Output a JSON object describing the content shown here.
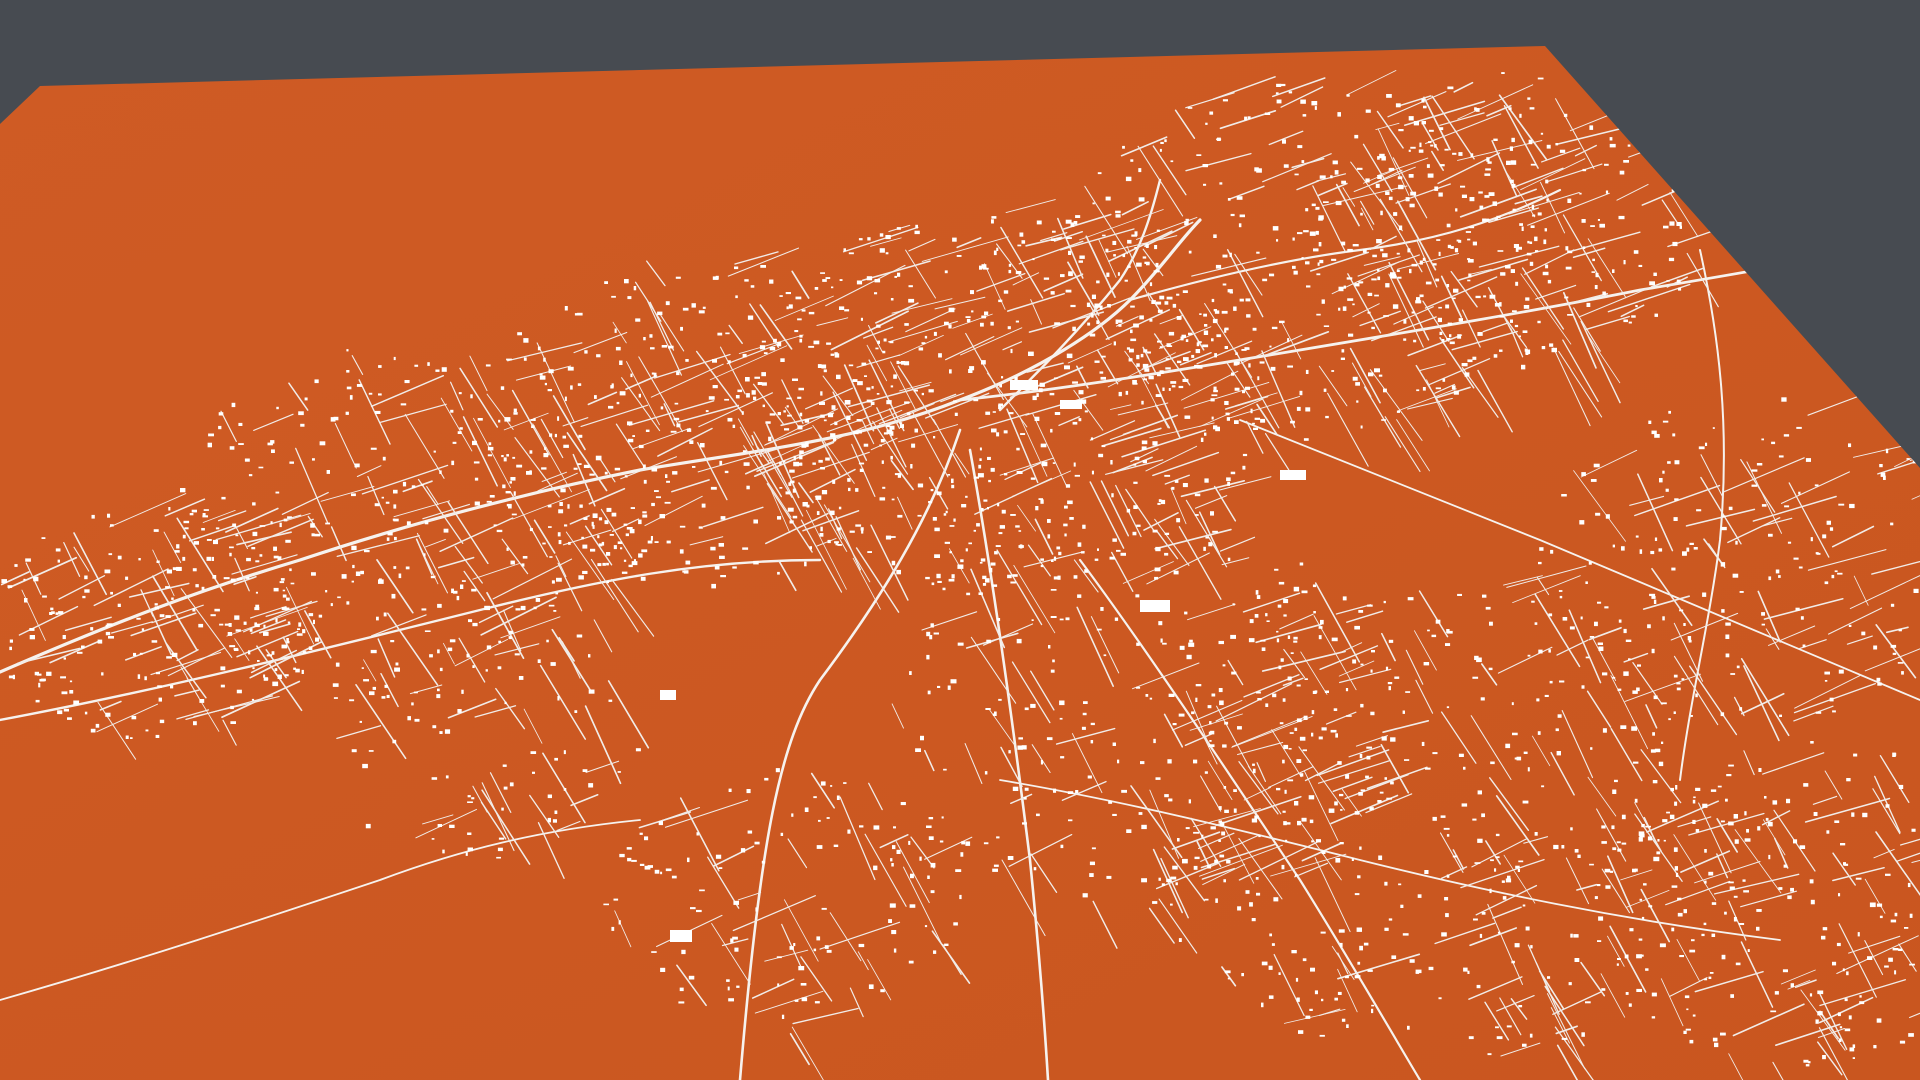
{
  "scene": {
    "description_label": "",
    "background_color": "#474b51",
    "terrain_color": "#cc5a24",
    "terrain_shade_color": "#c25220",
    "feature_color": "#ffffff",
    "road_color": "#f4f1ee"
  },
  "layers": [
    {
      "name": "terrain-plane"
    },
    {
      "name": "coastline-roads"
    },
    {
      "name": "main-roads"
    },
    {
      "name": "residential-streets"
    },
    {
      "name": "buildings"
    }
  ]
}
